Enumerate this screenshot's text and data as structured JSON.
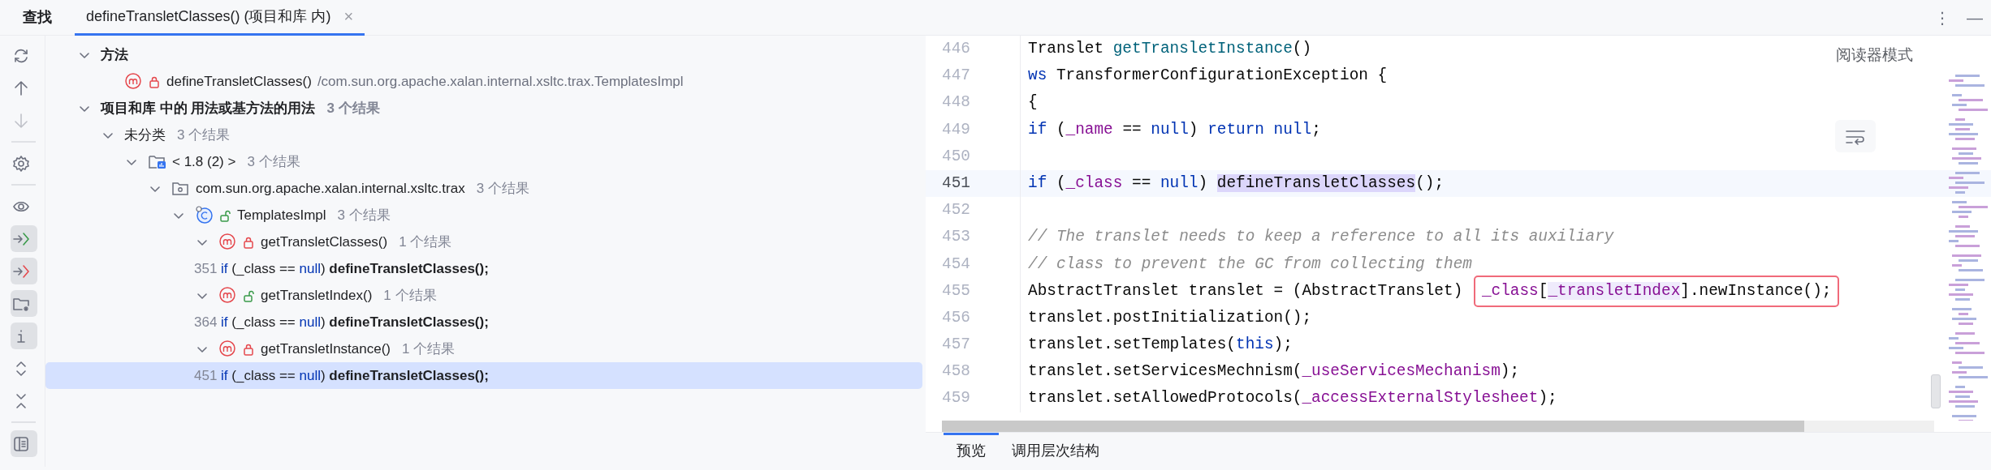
{
  "header": {
    "title": "查找",
    "tabs": [
      {
        "label": "defineTransletClasses() (项目和库 内)",
        "selected": true,
        "close": "×"
      }
    ],
    "menu": "⋮",
    "minimize": "—"
  },
  "toolbar": [
    {
      "kind": "refresh",
      "selected": false,
      "disabled": false
    },
    {
      "kind": "up",
      "selected": false,
      "disabled": false
    },
    {
      "kind": "down",
      "disabled": true
    },
    {
      "kind": "divider"
    },
    {
      "kind": "settings",
      "selected": false,
      "disabled": false
    },
    {
      "kind": "divider"
    },
    {
      "kind": "eye",
      "selected": false,
      "disabled": false
    },
    {
      "kind": "import",
      "selected": true,
      "disabled": false
    },
    {
      "kind": "export",
      "selected": true,
      "disabled": false
    },
    {
      "kind": "folder",
      "selected": true,
      "disabled": false
    },
    {
      "kind": "info",
      "selected": true,
      "disabled": false
    },
    {
      "kind": "expand",
      "selected": false,
      "disabled": false
    },
    {
      "kind": "collapse",
      "selected": false,
      "disabled": false
    },
    {
      "kind": "divider"
    },
    {
      "kind": "panel",
      "selected": true,
      "disabled": false
    }
  ],
  "tree": [
    {
      "kind": "group",
      "label": "方法",
      "expanded": true,
      "selected": false,
      "children": [
        {
          "kind": "method",
          "locked": true,
          "label": "defineTransletClasses()",
          "path": "/com.sun.org.apache.xalan.internal.xsltc.trax.TemplatesImpl",
          "selected": false
        }
      ]
    },
    {
      "kind": "group",
      "label": "项目和库 中的 用法或基方法的用法",
      "count": "3 个结果",
      "expanded": true,
      "selected": false,
      "children": [
        {
          "kind": "category",
          "label": "未分类",
          "count": "3 个结果",
          "expanded": true,
          "selected": false,
          "children": [
            {
              "kind": "library",
              "label": "< 1.8 (2) >",
              "count": "3 个结果",
              "expanded": true,
              "selected": false,
              "children": [
                {
                  "kind": "package",
                  "label": "com.sun.org.apache.xalan.internal.xsltc.trax",
                  "count": "3 个结果",
                  "expanded": true,
                  "selected": false,
                  "children": [
                    {
                      "kind": "class",
                      "locked": false,
                      "label": "TemplatesImpl",
                      "count": "3 个结果",
                      "expanded": true,
                      "selected": false,
                      "children": [
                        {
                          "kind": "method",
                          "locked": true,
                          "label": "getTransletClasses()",
                          "count": "1 个结果",
                          "expanded": true,
                          "selected": false,
                          "children": [
                            {
                              "kind": "usage",
                              "number": "351",
                              "selected": false,
                              "tokens": [
                                {
                                  "text": "if",
                                  "kind": "keyword"
                                },
                                {
                                  "text": " (_class == ",
                                  "kind": "plain"
                                },
                                {
                                  "text": "null",
                                  "kind": "keyword"
                                },
                                {
                                  "text": ") ",
                                  "kind": "plain"
                                },
                                {
                                  "text": "defineTransletClasses();",
                                  "kind": "match"
                                }
                              ]
                            }
                          ]
                        },
                        {
                          "kind": "method",
                          "locked": false,
                          "label": "getTransletIndex()",
                          "count": "1 个结果",
                          "expanded": true,
                          "selected": false,
                          "children": [
                            {
                              "kind": "usage",
                              "number": "364",
                              "selected": false,
                              "tokens": [
                                {
                                  "text": "if",
                                  "kind": "keyword"
                                },
                                {
                                  "text": " (_class == ",
                                  "kind": "plain"
                                },
                                {
                                  "text": "null",
                                  "kind": "keyword"
                                },
                                {
                                  "text": ") ",
                                  "kind": "plain"
                                },
                                {
                                  "text": "defineTransletClasses();",
                                  "kind": "match"
                                }
                              ]
                            }
                          ]
                        },
                        {
                          "kind": "method",
                          "locked": true,
                          "label": "getTransletInstance()",
                          "count": "1 个结果",
                          "expanded": true,
                          "selected": false,
                          "children": [
                            {
                              "kind": "usage",
                              "number": "451",
                              "selected": true,
                              "tokens": [
                                {
                                  "text": "if",
                                  "kind": "keyword"
                                },
                                {
                                  "text": " (_class == ",
                                  "kind": "plain"
                                },
                                {
                                  "text": "null",
                                  "kind": "keyword"
                                },
                                {
                                  "text": ") ",
                                  "kind": "plain"
                                },
                                {
                                  "text": "defineTransletClasses();",
                                  "kind": "match"
                                }
                              ]
                            }
                          ]
                        }
                      ]
                    }
                  ]
                }
              ]
            }
          ]
        }
      ]
    }
  ],
  "editor": {
    "reader_mode": "阅读器模式",
    "lines": [
      {
        "number": "446",
        "current": false,
        "tokens": [
          {
            "text": "Translet ",
            "kind": "plain"
          },
          {
            "text": "getTransletInstance",
            "kind": "method"
          },
          {
            "text": "()",
            "kind": "plain"
          }
        ]
      },
      {
        "number": "447",
        "current": false,
        "tokens": [
          {
            "text": "ws",
            "kind": "keyword"
          },
          {
            "text": " TransformerConfigurationException {",
            "kind": "plain"
          }
        ]
      },
      {
        "number": "448",
        "current": false,
        "tokens": [
          {
            "text": "{",
            "kind": "plain"
          }
        ]
      },
      {
        "number": "449",
        "current": false,
        "tokens": [
          {
            "text": "if",
            "kind": "keyword"
          },
          {
            "text": " (",
            "kind": "plain"
          },
          {
            "text": "_name",
            "kind": "field"
          },
          {
            "text": " == ",
            "kind": "plain"
          },
          {
            "text": "null",
            "kind": "keyword"
          },
          {
            "text": ") ",
            "kind": "plain"
          },
          {
            "text": "return null",
            "kind": "keyword"
          },
          {
            "text": ";",
            "kind": "plain"
          }
        ]
      },
      {
        "number": "450",
        "current": false
      },
      {
        "number": "451",
        "current": true,
        "tokens": [
          {
            "text": "if",
            "kind": "keyword"
          },
          {
            "text": " (",
            "kind": "plain"
          },
          {
            "text": "_class",
            "kind": "field"
          },
          {
            "text": " == ",
            "kind": "plain"
          },
          {
            "text": "null",
            "kind": "keyword"
          },
          {
            "text": ") ",
            "kind": "plain"
          },
          {
            "text": "defineTransletClasses",
            "kind": "usage"
          },
          {
            "text": "();",
            "kind": "plain"
          }
        ]
      },
      {
        "number": "452",
        "current": false
      },
      {
        "number": "453",
        "current": false,
        "tokens": [
          {
            "text": "// The translet needs to keep a reference to all its auxiliary",
            "kind": "comment"
          }
        ]
      },
      {
        "number": "454",
        "current": false,
        "tokens": [
          {
            "text": "// class to prevent the GC from collecting them",
            "kind": "comment"
          }
        ]
      },
      {
        "number": "455",
        "current": false,
        "tokens": [
          {
            "text": "AbstractTranslet translet = (AbstractTranslet) ",
            "kind": "plain"
          }
        ],
        "boxed_tokens": [
          {
            "text": "_class",
            "kind": "field"
          },
          {
            "text": "[",
            "kind": "plain"
          },
          {
            "text": "_transletIndex",
            "kind": "field-usage"
          },
          {
            "text": "].newInstance();",
            "kind": "plain"
          }
        ]
      },
      {
        "number": "456",
        "current": false,
        "tokens": [
          {
            "text": "translet.postInitialization();",
            "kind": "plain"
          }
        ]
      },
      {
        "number": "457",
        "current": false,
        "tokens": [
          {
            "text": "translet.setTemplates(",
            "kind": "plain"
          },
          {
            "text": "this",
            "kind": "keyword"
          },
          {
            "text": ");",
            "kind": "plain"
          }
        ]
      },
      {
        "number": "458",
        "current": false,
        "tokens": [
          {
            "text": "translet.setServicesMechnism(",
            "kind": "plain"
          },
          {
            "text": "_useServicesMechanism",
            "kind": "field"
          },
          {
            "text": ");",
            "kind": "plain"
          }
        ]
      },
      {
        "number": "459",
        "current": false,
        "tokens": [
          {
            "text": "translet.setAllowedProtocols(",
            "kind": "plain"
          },
          {
            "text": "_accessExternalStylesheet",
            "kind": "field"
          },
          {
            "text": ");",
            "kind": "plain"
          }
        ]
      }
    ]
  },
  "bottom_tabs": [
    {
      "label": "预览",
      "selected": true
    },
    {
      "label": "调用层次结构",
      "selected": false
    }
  ]
}
